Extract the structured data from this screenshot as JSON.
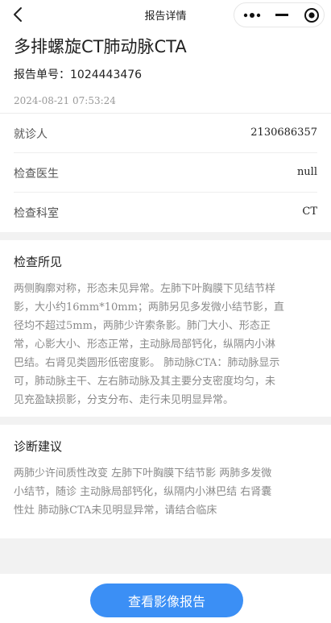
{
  "nav": {
    "title": "报告详情",
    "back_icon": "chevron-left-icon",
    "capsule": {
      "more_icon": "more-dots-icon",
      "minimize_icon": "minimize-icon",
      "close_icon": "target-close-icon"
    }
  },
  "report": {
    "title": "多排螺旋CT肺动脉CTA",
    "number_label": "报告单号：",
    "number": "1024443476",
    "time": "2024-08-21 07:53:24"
  },
  "info": [
    {
      "label": "就诊人",
      "value": "2130686357"
    },
    {
      "label": "检查医生",
      "value": "null"
    },
    {
      "label": "检查科室",
      "value": "CT"
    }
  ],
  "findings": {
    "title": "检查所见",
    "lines": [
      "两侧胸廓对称，形态未见异常。左肺下叶胸膜下见结节样",
      "影，大小约16mm*10mm；两肺另见多发微小结节影，直",
      "径均不超过5mm，两肺少许索条影。肺门大小、形态正",
      "常，心影大小、形态正常，主动脉局部钙化，纵隔内小淋",
      "巴结。右肾见类圆形低密度影。 肺动脉CTA：肺动脉显示",
      "可，肺动脉主干、左右肺动脉及其主要分支密度均匀，未",
      "见充盈缺损影，分支分布、走行未见明显异常。"
    ]
  },
  "diagnosis": {
    "title": "诊断建议",
    "lines": [
      "两肺少许间质性改变 左肺下叶胸膜下结节影 两肺多发微",
      "小结节，随诊 主动脉局部钙化，纵隔内小淋巴结 右肾囊",
      "性灶 肺动脉CTA未见明显异常，请结合临床"
    ]
  },
  "actions": {
    "view_images": "查看影像报告"
  },
  "colors": {
    "primary_button": "#3b8ff5",
    "muted_text": "#8a8a8a",
    "page_bg": "#f2f2f2"
  }
}
